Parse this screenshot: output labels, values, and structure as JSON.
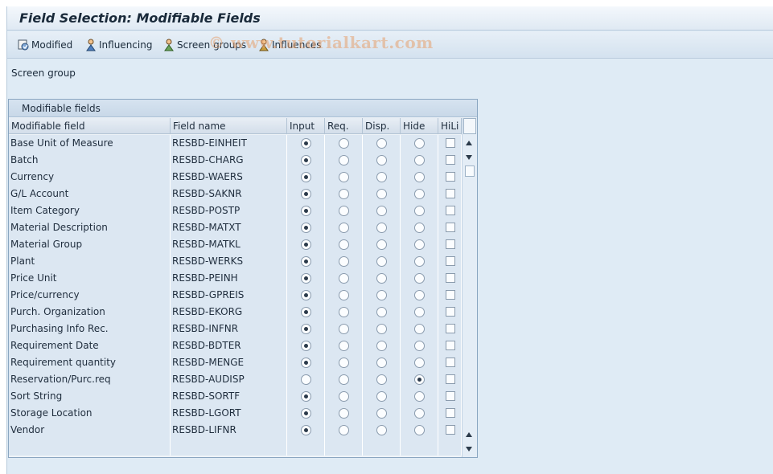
{
  "window": {
    "title": "Field Selection: Modifiable Fields"
  },
  "toolbar": {
    "modified": "Modified",
    "influencing": "Influencing",
    "screen_groups": "Screen groups",
    "influences": "Influences"
  },
  "watermark": "© www.tutorialkart.com",
  "screen_group_label": "Screen group",
  "table": {
    "title": "Modifiable fields",
    "columns": [
      "Modifiable field",
      "Field name",
      "Input",
      "Req.",
      "Disp.",
      "Hide",
      "HiLi"
    ],
    "rows": [
      {
        "field": "Base Unit of Measure",
        "name": "RESBD-EINHEIT",
        "selected": "input",
        "hili": false
      },
      {
        "field": "Batch",
        "name": "RESBD-CHARG",
        "selected": "input",
        "hili": false
      },
      {
        "field": "Currency",
        "name": "RESBD-WAERS",
        "selected": "input",
        "hili": false
      },
      {
        "field": "G/L Account",
        "name": "RESBD-SAKNR",
        "selected": "input",
        "hili": false
      },
      {
        "field": "Item Category",
        "name": "RESBD-POSTP",
        "selected": "input",
        "hili": false
      },
      {
        "field": "Material Description",
        "name": "RESBD-MATXT",
        "selected": "input",
        "hili": false
      },
      {
        "field": "Material Group",
        "name": "RESBD-MATKL",
        "selected": "input",
        "hili": false
      },
      {
        "field": "Plant",
        "name": "RESBD-WERKS",
        "selected": "input",
        "hili": false
      },
      {
        "field": "Price Unit",
        "name": "RESBD-PEINH",
        "selected": "input",
        "hili": false
      },
      {
        "field": "Price/currency",
        "name": "RESBD-GPREIS",
        "selected": "input",
        "hili": false
      },
      {
        "field": "Purch. Organization",
        "name": "RESBD-EKORG",
        "selected": "input",
        "hili": false
      },
      {
        "field": "Purchasing Info Rec.",
        "name": "RESBD-INFNR",
        "selected": "input",
        "hili": false
      },
      {
        "field": "Requirement Date",
        "name": "RESBD-BDTER",
        "selected": "input",
        "hili": false
      },
      {
        "field": "Requirement quantity",
        "name": "RESBD-MENGE",
        "selected": "input",
        "hili": false
      },
      {
        "field": "Reservation/Purc.req",
        "name": "RESBD-AUDISP",
        "selected": "hide",
        "hili": false
      },
      {
        "field": "Sort String",
        "name": "RESBD-SORTF",
        "selected": "input",
        "hili": false
      },
      {
        "field": "Storage Location",
        "name": "RESBD-LGORT",
        "selected": "input",
        "hili": false
      },
      {
        "field": "Vendor",
        "name": "RESBD-LIFNR",
        "selected": "input",
        "hili": false
      },
      {
        "field": "",
        "name": "",
        "selected": null,
        "hili": null
      }
    ]
  },
  "colors": {
    "background": "#dfebf5",
    "cell": "#dce7f2",
    "header": "#d3deea"
  },
  "icons": [
    "modified-icon",
    "influencing-icon",
    "screen-groups-icon",
    "influences-icon"
  ]
}
